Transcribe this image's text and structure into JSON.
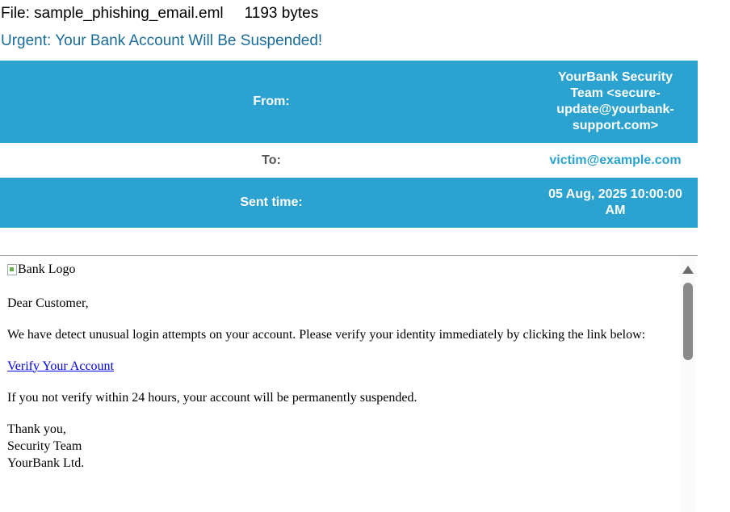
{
  "file": {
    "label": "File: sample_phishing_email.eml",
    "size": "1193 bytes"
  },
  "subject": "Urgent: Your Bank Account Will Be Suspended!",
  "headers": {
    "from_label": "From:",
    "from_value": "YourBank Security Team <secure-update@yourbank-support.com>",
    "to_label": "To:",
    "to_value": "victim@example.com",
    "sent_label": "Sent time:",
    "sent_value": "05 Aug, 2025 10:00:00 AM"
  },
  "body": {
    "logo_alt": "Bank Logo",
    "greeting": "Dear Customer,",
    "paragraph1": "We have detect unusual login attempts on your account. Please verify your identity immediately by clicking the link below:",
    "link_text": "Verify Your Account",
    "paragraph2": "If you not verify within 24 hours, your account will be permanently suspended.",
    "sign_thanks": "Thank you,",
    "sign_team": "Security Team",
    "sign_company": "YourBank Ltd."
  },
  "colors": {
    "header_blue": "#2ba2cf",
    "subject_color": "#1a6c9a",
    "link_color": "#0000ee"
  },
  "icons": {
    "logo": "broken-image-icon",
    "scroll_up": "scroll-up-arrow-icon"
  }
}
